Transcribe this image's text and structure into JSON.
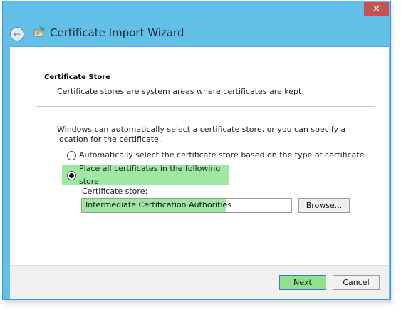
{
  "window": {
    "title": "Certificate Import Wizard",
    "close_glyph": "✕",
    "back_glyph": "←",
    "accent_color": "#62bfe8"
  },
  "header": {
    "section_title": "Certificate Store",
    "section_desc": "Certificate stores are system areas where certificates are kept."
  },
  "body": {
    "info_text": "Windows can automatically select a certificate store, or you can specify a location for the certificate.",
    "options": [
      {
        "label": "Automatically select the certificate store based on the type of certificate",
        "selected": false
      },
      {
        "label": "Place all certificates in the following store",
        "selected": true
      }
    ],
    "store_label": "Certificate store:",
    "store_value": "Intermediate Certification Authorities",
    "browse_label": "Browse..."
  },
  "footer": {
    "next_label": "Next",
    "cancel_label": "Cancel"
  },
  "highlight_color": "#9fe8a3"
}
